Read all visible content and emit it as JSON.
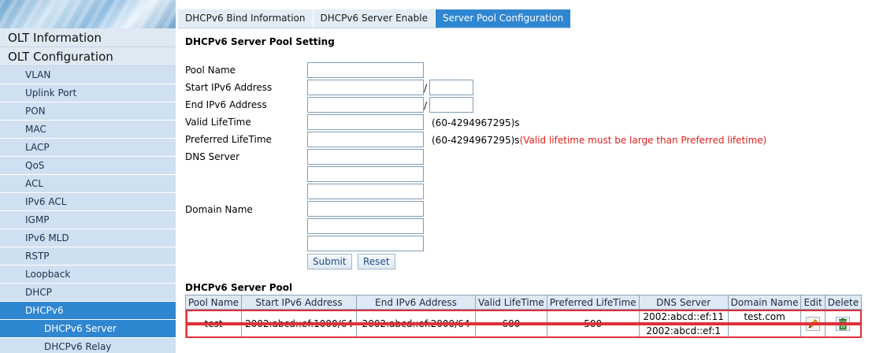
{
  "sidebar": {
    "sections": [
      {
        "label": "OLT Information"
      },
      {
        "label": "OLT Configuration"
      }
    ],
    "items": [
      {
        "label": "VLAN"
      },
      {
        "label": "Uplink Port"
      },
      {
        "label": "PON"
      },
      {
        "label": "MAC"
      },
      {
        "label": "LACP"
      },
      {
        "label": "QoS"
      },
      {
        "label": "ACL"
      },
      {
        "label": "IPv6 ACL"
      },
      {
        "label": "IGMP"
      },
      {
        "label": "IPv6 MLD"
      },
      {
        "label": "RSTP"
      },
      {
        "label": "Loopback"
      },
      {
        "label": "DHCP"
      },
      {
        "label": "DHCPv6"
      }
    ],
    "subitems": [
      {
        "label": "DHCPv6 Server"
      },
      {
        "label": "DHCPv6 Relay"
      }
    ]
  },
  "tabs": [
    {
      "label": "DHCPv6 Bind Information"
    },
    {
      "label": "DHCPv6 Server Enable"
    },
    {
      "label": "Server Pool Configuration"
    }
  ],
  "form": {
    "title": "DHCPv6 Server Pool Setting",
    "pool_name_label": "Pool Name",
    "start_label": "Start IPv6 Address",
    "end_label": "End IPv6 Address",
    "valid_label": "Valid LifeTime",
    "preferred_label": "Preferred LifeTime",
    "dns_label": "DNS Server",
    "domain_label": "Domain Name",
    "slash": "/",
    "valid_hint": "(60-4294967295)s",
    "preferred_hint": "(60-4294967295)s",
    "preferred_warn": "(Valid lifetime must be large than Preferred lifetime)",
    "submit_label": "Submit",
    "reset_label": "Reset"
  },
  "pool_table": {
    "title": "DHCPv6 Server Pool",
    "headers": [
      "Pool Name",
      "Start IPv6 Address",
      "End IPv6 Address",
      "Valid LifeTime",
      "Preferred LifeTime",
      "DNS Server",
      "Domain Name",
      "Edit",
      "Delete"
    ],
    "rows": [
      {
        "pool_name": "test",
        "start": "2002:abcd::ef:1000/64",
        "end": "2002:abcd::ef:2000/64",
        "valid": "600",
        "preferred": "500",
        "dns1": "2002:abcd::ef:11",
        "dns2": "2002:abcd::ef:1",
        "domain": "test.com"
      }
    ]
  },
  "icons": {
    "edit": "pencil-icon",
    "delete": "trash-icon"
  },
  "colors": {
    "accent": "#2f86d1",
    "warning": "#e0201a",
    "highlight": "#e0303a"
  }
}
